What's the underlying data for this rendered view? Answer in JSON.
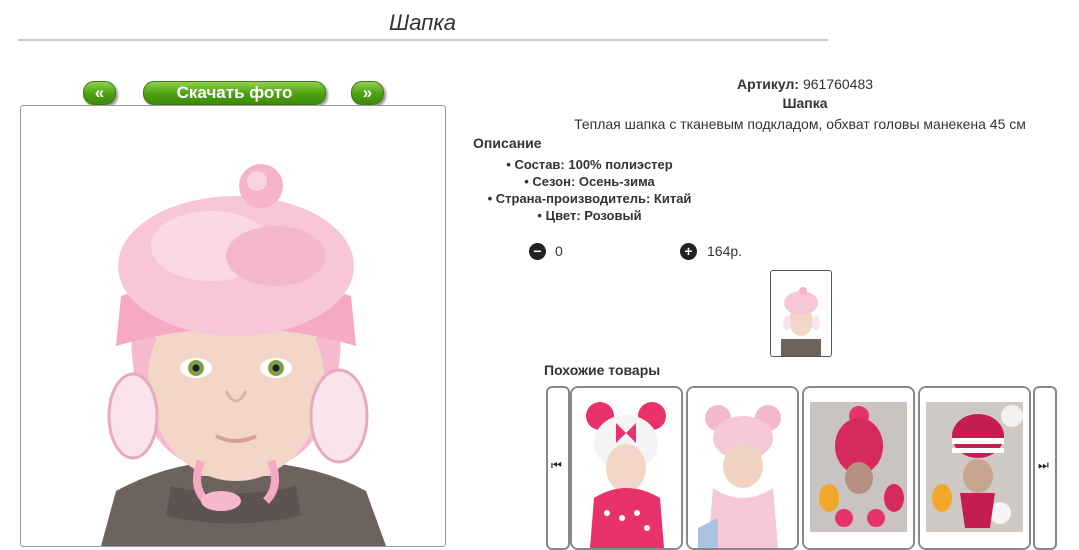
{
  "page": {
    "title": "Шапка"
  },
  "gallery": {
    "prev_label": "«",
    "download_label": "Скачать фото",
    "next_label": "»"
  },
  "product": {
    "sku_label": "Артикул:",
    "sku_value": "961760483",
    "name": "Шапка",
    "short_description": "Теплая шапка с тканевым подкладом, обхват головы манекена 45 см",
    "description_heading": "Описание",
    "attributes": [
      "Состав: 100% полиэстер",
      "Сезон: Осень-зима",
      "Страна-производитель: Китай",
      "Цвет: Розовый"
    ]
  },
  "cart": {
    "minus_icon": "−",
    "plus_icon": "+",
    "quantity": "0",
    "price": "164р."
  },
  "similar": {
    "heading": "Похожие товары",
    "prev_icon": "⏮",
    "next_icon": "⏭"
  }
}
